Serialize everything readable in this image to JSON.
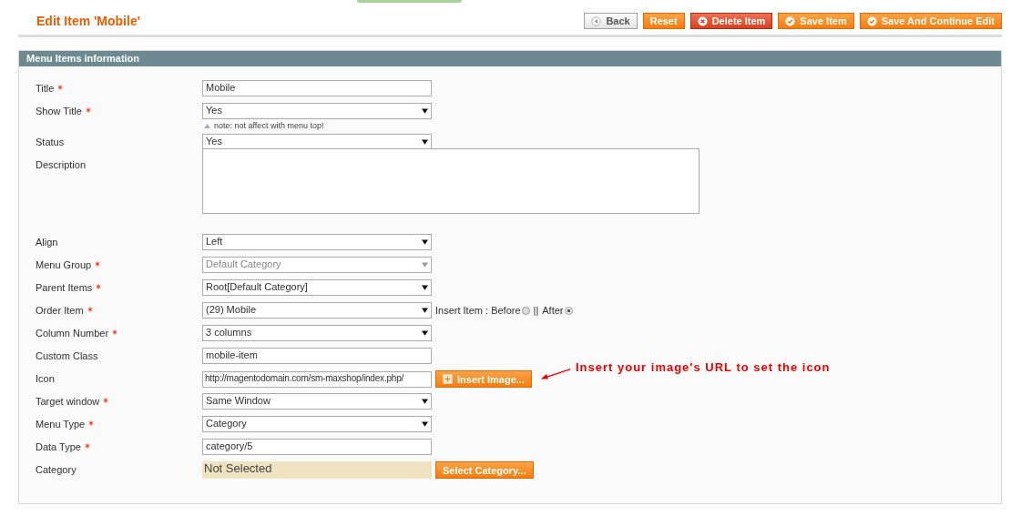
{
  "header": {
    "title": "Edit Item 'Mobile'"
  },
  "buttons": [
    {
      "label": "Back",
      "kind": "back"
    },
    {
      "label": "Reset",
      "kind": "plain"
    },
    {
      "label": "Delete Item",
      "kind": "delete"
    },
    {
      "label": "Save Item",
      "kind": "save"
    },
    {
      "label": "Save And Continue Edit",
      "kind": "save"
    }
  ],
  "section": {
    "title": "Menu Items information"
  },
  "fields": [
    {
      "label": "Title",
      "required": true,
      "kind": "text",
      "value": "Mobile"
    },
    {
      "label": "Show Title",
      "required": true,
      "kind": "select",
      "value": "Yes",
      "note": "note: not affect with menu top!"
    },
    {
      "label": "Status",
      "required": false,
      "kind": "select",
      "value": "Yes"
    },
    {
      "label": "Description",
      "required": false,
      "kind": "textarea"
    },
    {
      "label": "Align",
      "required": false,
      "kind": "select",
      "value": "Left"
    },
    {
      "label": "Menu Group",
      "required": true,
      "kind": "select",
      "value": "Default Category",
      "disabled": true
    },
    {
      "label": "Parent Items",
      "required": true,
      "kind": "select",
      "value": "Root[Default Category]"
    },
    {
      "label": "Order Item",
      "required": true,
      "kind": "select",
      "value": "(29) Mobile",
      "insert": {
        "label": "Insert Item : Before",
        "separator": "||",
        "after_label": "After",
        "options": [
          {
            "selected": false
          },
          {
            "selected": true
          }
        ]
      }
    },
    {
      "label": "Column Number",
      "required": true,
      "kind": "select",
      "value": "3 columns"
    },
    {
      "label": "Custom Class",
      "required": false,
      "kind": "text",
      "value": "mobile-item"
    },
    {
      "label": "Icon",
      "required": false,
      "kind": "text",
      "value": "http://magentodomain.com/sm-maxshop/index.php/",
      "button": "Insert Image...",
      "annotation": "Insert your image's URL to set the icon"
    },
    {
      "label": "Target window",
      "required": true,
      "kind": "select",
      "value": "Same Window"
    },
    {
      "label": "Menu Type",
      "required": true,
      "kind": "select",
      "value": "Category"
    },
    {
      "label": "Data Type",
      "required": true,
      "kind": "text",
      "value": "category/5"
    },
    {
      "label": "Category",
      "required": false,
      "kind": "category",
      "value": "Not Selected",
      "button": "Select Category..."
    }
  ]
}
